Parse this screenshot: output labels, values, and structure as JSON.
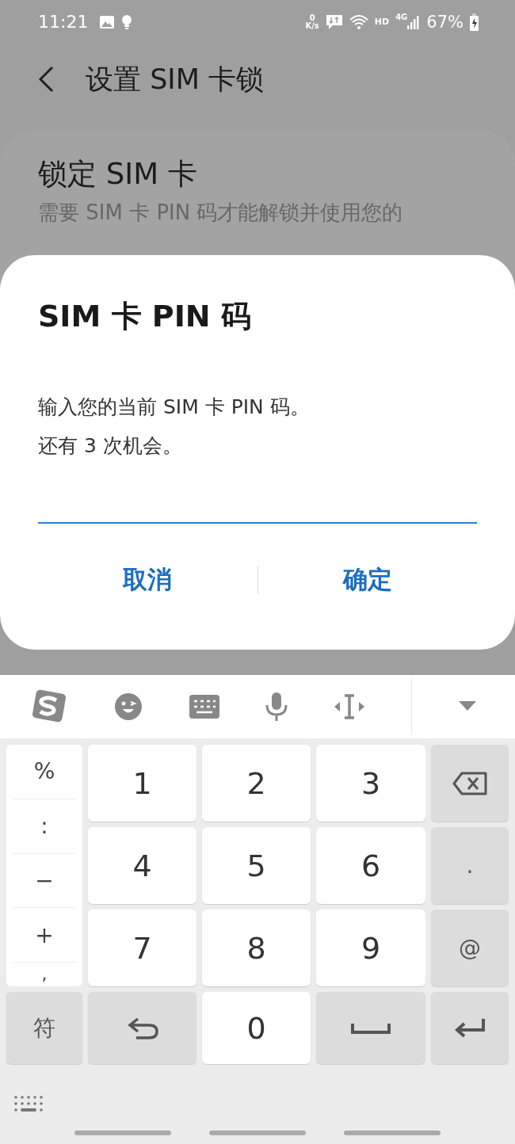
{
  "status_bar": {
    "time": "11:21",
    "net_speed_value": "0",
    "net_speed_unit": "K/s",
    "hd": "HD",
    "network": "4G",
    "battery": "67%"
  },
  "header": {
    "title": "设置 SIM 卡锁"
  },
  "setting": {
    "title": "锁定 SIM 卡",
    "description": "需要 SIM 卡 PIN 码才能解锁并使用您的"
  },
  "dialog": {
    "title": "SIM 卡 PIN 码",
    "message_lines": [
      "输入您的当前 SIM 卡 PIN 码。",
      "还有 3 次机会。"
    ],
    "buttons": [
      "取消",
      "确定"
    ]
  },
  "keyboard": {
    "symbols": [
      "%",
      ":",
      "−",
      "+",
      ","
    ],
    "keys": [
      {
        "kind": "digit",
        "label": "1"
      },
      {
        "kind": "digit",
        "label": "2"
      },
      {
        "kind": "digit",
        "label": "3"
      },
      {
        "kind": "backspace"
      },
      {
        "kind": "digit",
        "label": "4"
      },
      {
        "kind": "digit",
        "label": "5"
      },
      {
        "kind": "digit",
        "label": "6"
      },
      {
        "kind": "symbol",
        "label": "."
      },
      {
        "kind": "digit",
        "label": "7"
      },
      {
        "kind": "digit",
        "label": "8"
      },
      {
        "kind": "digit",
        "label": "9"
      },
      {
        "kind": "symbol",
        "label": "@"
      },
      {
        "kind": "symbol",
        "label": "符"
      },
      {
        "kind": "undo"
      },
      {
        "kind": "digit",
        "label": "0"
      },
      {
        "kind": "space"
      },
      {
        "kind": "enter"
      }
    ]
  }
}
